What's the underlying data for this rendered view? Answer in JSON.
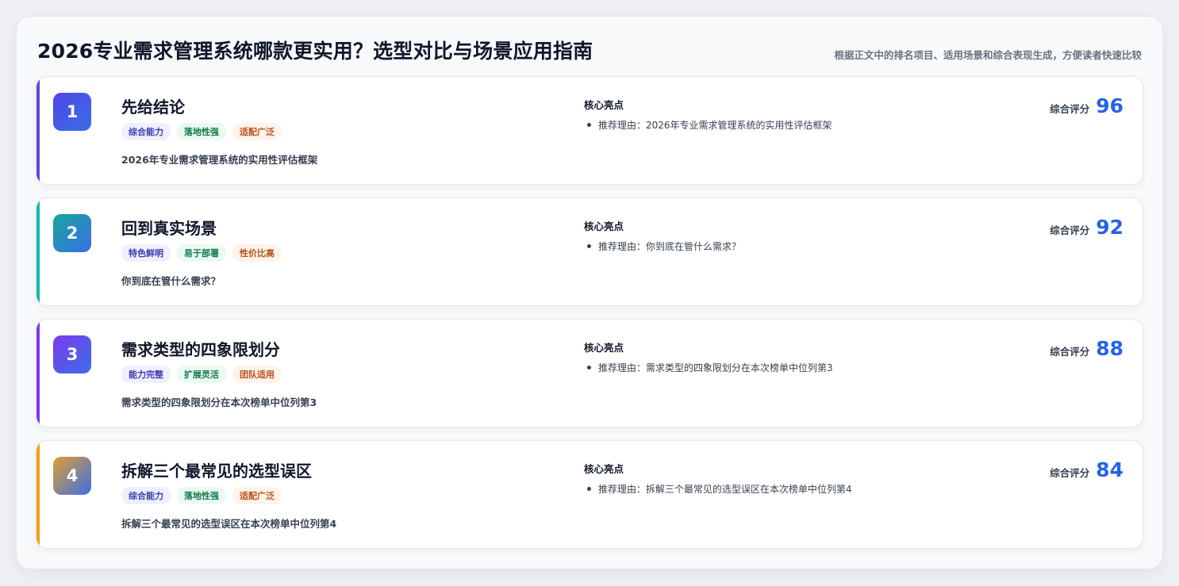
{
  "header": {
    "title": "2026专业需求管理系统哪款更实用？选型对比与场景应用指南",
    "subtitle": "根据正文中的排名项目、适用场景和综合表现生成，方便读者快速比较"
  },
  "highlights_label": "核心亮点",
  "score_label": "综合评分",
  "items": [
    {
      "rank": "1",
      "name": "先给结论",
      "tags": [
        "综合能力",
        "落地性强",
        "适配广泛"
      ],
      "desc": "2026年专业需求管理系统的实用性评估框架",
      "highlight": "推荐理由：2026年专业需求管理系统的实用性评估框架",
      "score": "96",
      "accent": "#5b4bd6",
      "badge_gradient": [
        "#4f46e5",
        "#3b6ee8"
      ]
    },
    {
      "rank": "2",
      "name": "回到真实场景",
      "tags": [
        "特色鲜明",
        "易于部署",
        "性价比高"
      ],
      "desc": "你到底在管什么需求？",
      "highlight": "推荐理由：你到底在管什么需求？",
      "score": "92",
      "accent": "#14b8a6",
      "badge_gradient": [
        "#14a89a",
        "#3b6ee8"
      ]
    },
    {
      "rank": "3",
      "name": "需求类型的四象限划分",
      "tags": [
        "能力完整",
        "扩展灵活",
        "团队适用"
      ],
      "desc": "需求类型的四象限划分在本次榜单中位列第3",
      "highlight": "推荐理由：需求类型的四象限划分在本次榜单中位列第3",
      "score": "88",
      "accent": "#7c3aed",
      "badge_gradient": [
        "#7c3aed",
        "#3b6ee8"
      ]
    },
    {
      "rank": "4",
      "name": "拆解三个最常见的选型误区",
      "tags": [
        "综合能力",
        "落地性强",
        "适配广泛"
      ],
      "desc": "拆解三个最常见的选型误区在本次榜单中位列第4",
      "highlight": "推荐理由：拆解三个最常见的选型误区在本次榜单中位列第4",
      "score": "84",
      "accent": "#f59e0b",
      "badge_gradient": [
        "#e0a030",
        "#3b6ee8"
      ]
    }
  ]
}
